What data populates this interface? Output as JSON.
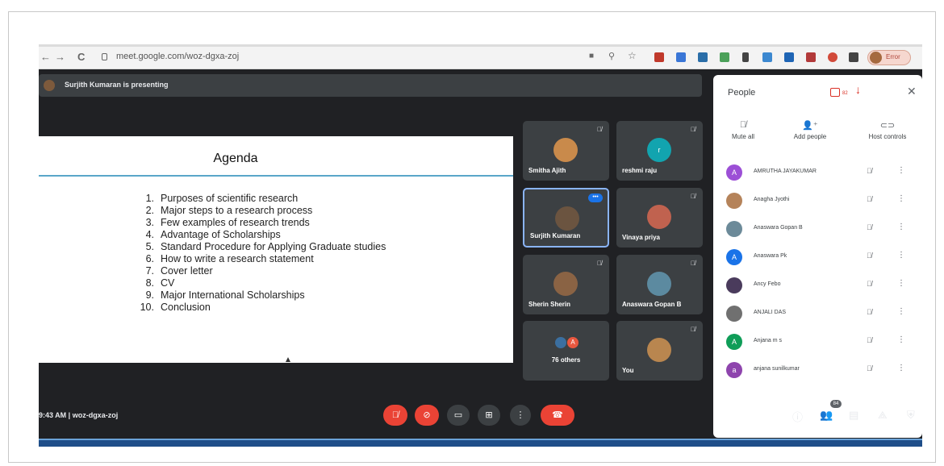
{
  "browser": {
    "back": "←",
    "forward": "→",
    "reload": "C",
    "url": "meet.google.com/woz-dgxa-zoj",
    "profile_label": "Error",
    "extensions": [
      "#c0392b",
      "#3a76d6",
      "#2b6ea8",
      "#4ca15a",
      "#444444",
      "#3c88d0",
      "#1f65b5",
      "#b23a3a",
      "#d24a3a",
      "#444444"
    ]
  },
  "meet": {
    "presenting_text": "Surjith Kumaran is presenting",
    "meeting_code": "9:43 AM  |  woz-dgxa-zoj",
    "slide": {
      "title": "Agenda",
      "items": [
        {
          "num": "1.",
          "text": "Purposes of scientific research"
        },
        {
          "num": "2.",
          "text": "Major steps to a research process"
        },
        {
          "num": "3.",
          "text": "Few examples of research trends"
        },
        {
          "num": "4.",
          "text": "Advantage of Scholarships"
        },
        {
          "num": "5.",
          "text": "Standard Procedure for Applying Graduate studies"
        },
        {
          "num": "6.",
          "text": "How to write a research statement"
        },
        {
          "num": "7.",
          "text": "Cover letter"
        },
        {
          "num": "8.",
          "text": "CV"
        },
        {
          "num": "9.",
          "text": "Major International Scholarships"
        },
        {
          "num": "10.",
          "text": "Conclusion"
        }
      ]
    },
    "tiles": [
      {
        "name": "Smitha Ajith",
        "avatar_letter": ""
      },
      {
        "name": "reshmi raju",
        "avatar_letter": "r"
      },
      {
        "name": "Surjith Kumaran",
        "avatar_letter": ""
      },
      {
        "name": "Vinaya priya",
        "avatar_letter": ""
      },
      {
        "name": "Sherin Sherin",
        "avatar_letter": ""
      },
      {
        "name": "Anaswara Gopan B",
        "avatar_letter": ""
      },
      {
        "name": "76 others",
        "avatar_letter": "A"
      },
      {
        "name": "You",
        "avatar_letter": ""
      }
    ],
    "people_panel": {
      "title": "People",
      "badge_count": "82",
      "actions": [
        "Mute all",
        "Add people",
        "Host controls"
      ],
      "participants": [
        {
          "name": "AMRUTHA JAYAKUMAR",
          "letter": "A",
          "color": "#9c4fd6"
        },
        {
          "name": "Anagha Jyothi",
          "letter": "",
          "color": "#b5835a"
        },
        {
          "name": "Anaswara Gopan B",
          "letter": "",
          "color": "#6c8a99"
        },
        {
          "name": "Anaswara Pk",
          "letter": "A",
          "color": "#1a73e8"
        },
        {
          "name": "Ancy Febo",
          "letter": "",
          "color": "#4a3b5c"
        },
        {
          "name": "ANJALI DAS",
          "letter": "",
          "color": "#707070"
        },
        {
          "name": "Anjana m s",
          "letter": "A",
          "color": "#0f9d58"
        },
        {
          "name": "anjana sunilkumar",
          "letter": "a",
          "color": "#8e44ad"
        }
      ]
    },
    "people_count": "84"
  }
}
